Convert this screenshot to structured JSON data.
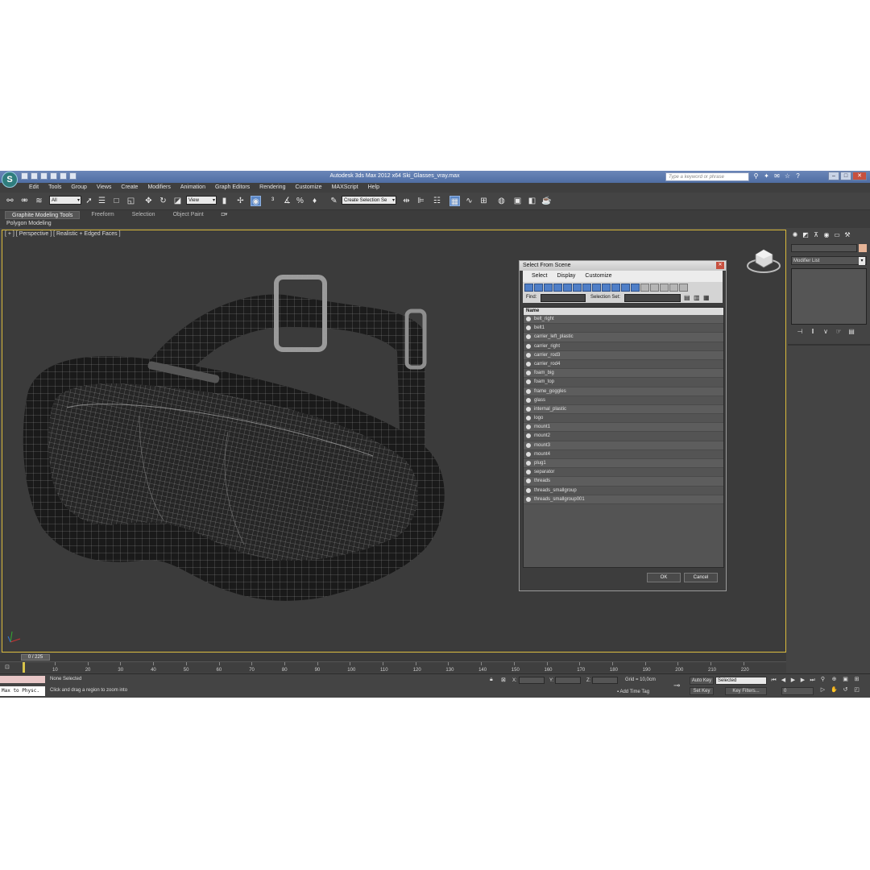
{
  "window": {
    "logo": "S",
    "title": "Autodesk 3ds Max  2012 x64     Ski_Glasses_vray.max",
    "search_placeholder": "Type a keyword or phrase"
  },
  "menu": [
    "Edit",
    "Tools",
    "Group",
    "Views",
    "Create",
    "Modifiers",
    "Animation",
    "Graph Editors",
    "Rendering",
    "Customize",
    "MAXScript",
    "Help"
  ],
  "toolbar": {
    "filter_value": "All",
    "refcoord_value": "View",
    "selection_set_value": "Create Selection Se"
  },
  "ribbon": {
    "tabs": [
      "Graphite Modeling Tools",
      "Freeform",
      "Selection",
      "Object Paint"
    ],
    "sub_label": "Polygon Modeling"
  },
  "viewport": {
    "label": "[ + ] [ Perspective ] [ Realistic + Edged Faces ]"
  },
  "dialog": {
    "title": "Select From Scene",
    "menu": [
      "Select",
      "Display",
      "Customize"
    ],
    "find_label": "Find:",
    "selection_set_label": "Selection Set:",
    "column_header": "Name",
    "items": [
      "belt_right",
      "belt1",
      "carrier_left_plastic",
      "carrier_right",
      "carrier_rod3",
      "carrier_rod4",
      "foam_big",
      "foam_top",
      "frame_goggles",
      "glass",
      "internal_plastic",
      "logo",
      "mount1",
      "mount2",
      "mount3",
      "mount4",
      "plug1",
      "separator",
      "threads",
      "threads_smallgroup",
      "threads_smallgroup001"
    ],
    "ok_label": "OK",
    "cancel_label": "Cancel"
  },
  "command_panel": {
    "modifier_list_label": "Modifier List",
    "swatch_color": "#e6b497"
  },
  "timeline": {
    "frame_display": "0 / 225",
    "ticks": [
      "10",
      "20",
      "30",
      "40",
      "50",
      "60",
      "70",
      "80",
      "90",
      "100",
      "110",
      "120",
      "130",
      "140",
      "150",
      "160",
      "170",
      "180",
      "190",
      "200",
      "210",
      "220"
    ]
  },
  "status": {
    "script_label": "Max to Physc.",
    "selection_status": "None Selected",
    "prompt": "Click and drag a region to zoom into",
    "x_label": "X:",
    "y_label": "Y:",
    "z_label": "Z:",
    "grid": "Grid = 10,0cm",
    "add_time_tag": "Add Time Tag",
    "auto_key": "Auto Key",
    "set_key": "Set Key",
    "key_mode_value": "Selected",
    "key_filters": "Key Filters...",
    "current_frame": "0"
  }
}
